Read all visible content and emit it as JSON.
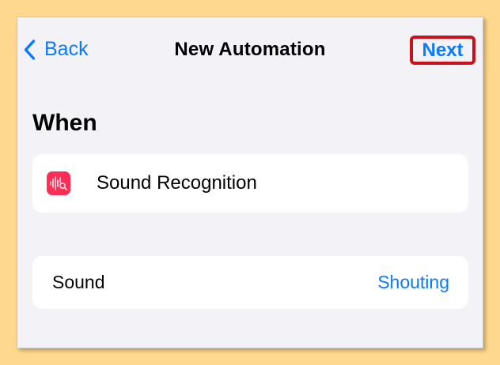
{
  "nav": {
    "back_label": "Back",
    "title": "New Automation",
    "next_label": "Next"
  },
  "when": {
    "heading": "When",
    "trigger": {
      "label": "Sound Recognition",
      "icon": "sound-recognition-icon"
    }
  },
  "sound_row": {
    "label": "Sound",
    "value": "Shouting"
  },
  "colors": {
    "accent": "#0a7aff",
    "background": "#f2f2f7",
    "icon_bg": "#ff2d55",
    "highlight_border": "#c8111a"
  }
}
